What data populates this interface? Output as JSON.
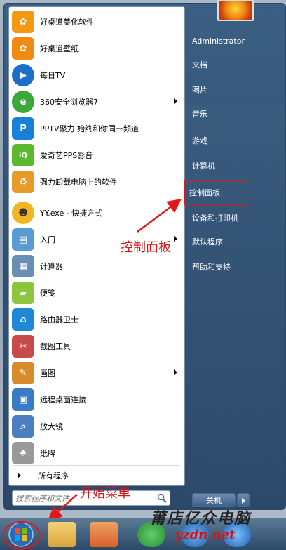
{
  "left_items": [
    {
      "label": "好桌道美化软件",
      "icon": "orange-flower-icon",
      "color": "#f39a12"
    },
    {
      "label": "好桌道壁纸",
      "icon": "orange-flower-icon",
      "color": "#f08a10"
    },
    {
      "label": "每日TV",
      "icon": "play-icon",
      "color": "#1c6fc9"
    },
    {
      "label": "360安全浏览器7",
      "icon": "browser-icon",
      "color": "#3aa83a"
    },
    {
      "label": "PPTV聚力 始终和你同一频道",
      "icon": "pptv-icon",
      "color": "#1980d8"
    },
    {
      "label": "爱奇艺PPS影音",
      "icon": "iqiyi-icon",
      "color": "#5cb82e"
    },
    {
      "label": "强力卸载电脑上的软件",
      "icon": "uninstall-icon",
      "color": "#e89b2a"
    },
    {
      "label": "YY.exe - 快捷方式",
      "icon": "yy-icon",
      "color": "#f3b51f"
    },
    {
      "label": "入门",
      "icon": "getting-started-icon",
      "color": "#5a9bd4"
    },
    {
      "label": "计算器",
      "icon": "calculator-icon",
      "color": "#6a8fb5"
    },
    {
      "label": "便笺",
      "icon": "sticky-note-icon",
      "color": "#8cc63f"
    },
    {
      "label": "路由器卫士",
      "icon": "router-icon",
      "color": "#1e88d6"
    },
    {
      "label": "截图工具",
      "icon": "scissors-icon",
      "color": "#c94a4a"
    },
    {
      "label": "画图",
      "icon": "paint-icon",
      "color": "#d88b2a"
    },
    {
      "label": "远程桌面连接",
      "icon": "remote-desktop-icon",
      "color": "#3a7bc8"
    },
    {
      "label": "放大镜",
      "icon": "magnifier-icon",
      "color": "#4a7fbf"
    },
    {
      "label": "纸牌",
      "icon": "cards-icon",
      "color": "#999999"
    }
  ],
  "all_programs": "所有程序",
  "search_placeholder": "搜索程序和文件",
  "right_items": [
    {
      "label": "Administrator"
    },
    {
      "label": "文档"
    },
    {
      "label": "图片"
    },
    {
      "label": "音乐"
    },
    {
      "label": "游戏"
    },
    {
      "label": "计算机"
    },
    {
      "label": "控制面板"
    },
    {
      "label": "设备和打印机"
    },
    {
      "label": "默认程序"
    },
    {
      "label": "帮助和支持"
    }
  ],
  "shutdown_label": "关机",
  "annotation_control_panel": "控制面板",
  "annotation_start": "开始菜单",
  "watermark": "莆店亿众电脑",
  "watermark_url": "yzdn.net"
}
